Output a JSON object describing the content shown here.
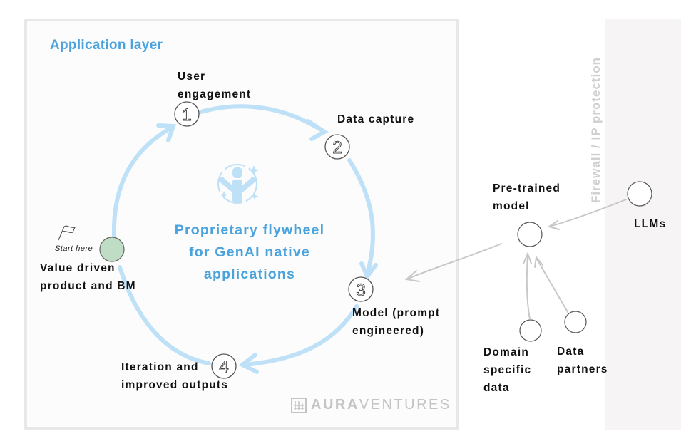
{
  "diagram": {
    "application_layer_title": "Application layer",
    "center_title": "Proprietary flywheel\nfor GenAI native\napplications",
    "start_label": "Start here",
    "steps": [
      {
        "number": "1",
        "label": "User\nengagement"
      },
      {
        "number": "2",
        "label": "Data capture"
      },
      {
        "number": "3",
        "label": "Model (prompt\nengineered)"
      },
      {
        "number": "4",
        "label": "Iteration and\nimproved outputs"
      }
    ],
    "start_node_label": "Value driven\nproduct and BM",
    "external": {
      "firewall_label": "Firewall / IP protection",
      "pretrained_label": "Pre-trained\nmodel",
      "llms_label": "LLMs",
      "domain_data_label": "Domain\nspecific\ndata",
      "data_partners_label": "Data\npartners"
    },
    "logo": {
      "bold": "AURA",
      "light": "VENTURES",
      "icon": "grid-logo-icon"
    },
    "colors": {
      "accent_blue": "#4aa3dc",
      "cycle_arrow": "#bfe1f7",
      "start_node": "#bfdcc4",
      "connector_gray": "#c8c8c8"
    }
  }
}
